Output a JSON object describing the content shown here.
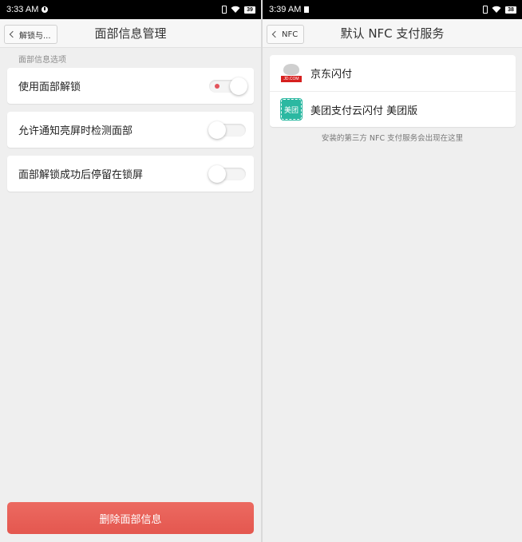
{
  "left": {
    "status": {
      "time": "3:33 AM",
      "battery": "39"
    },
    "back_label": "解锁与...",
    "title": "面部信息管理",
    "section_label": "面部信息选项",
    "options": [
      {
        "label": "使用面部解锁",
        "enabled": true
      },
      {
        "label": "允许通知亮屏时检测面部",
        "enabled": false
      },
      {
        "label": "面部解锁成功后停留在锁屏",
        "enabled": false
      }
    ],
    "delete_label": "删除面部信息",
    "colors": {
      "delete": "#e8605a",
      "toggle_dot": "#e2545c"
    }
  },
  "right": {
    "status": {
      "time": "3:39 AM",
      "battery": "38"
    },
    "back_label": "NFC",
    "title": "默认 NFC 支付服务",
    "services": [
      {
        "name": "京东闪付",
        "icon": "jd-logo-icon",
        "icon_text": "JD.COM"
      },
      {
        "name": "美团支付云闪付 美团版",
        "icon": "meituan-logo-icon",
        "icon_text": "美团"
      }
    ],
    "info": "安装的第三方 NFC 支付服务会出现在这里"
  }
}
